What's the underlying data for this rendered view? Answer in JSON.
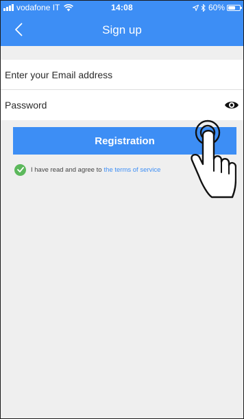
{
  "status_bar": {
    "carrier": "vodafone IT",
    "time": "14:08",
    "battery": "60%",
    "battery_level": 0.6,
    "icons": [
      "signal-icon",
      "wifi-icon",
      "location-icon",
      "bluetooth-icon",
      "battery-icon"
    ]
  },
  "nav": {
    "title": "Sign up",
    "back_icon": "chevron-left-icon"
  },
  "form": {
    "email": {
      "value": "",
      "placeholder": "Enter your Email address"
    },
    "password": {
      "value": "",
      "placeholder": "Password",
      "visibility_icon": "eye-icon"
    },
    "submit_label": "Registration"
  },
  "terms": {
    "checked": true,
    "text": "I have read and agree to",
    "link_text": "the terms of service"
  },
  "overlay": {
    "icon": "tap-hand-icon"
  },
  "colors": {
    "accent": "#3d8ef5",
    "background": "#efefef",
    "check": "#5cb85c"
  }
}
